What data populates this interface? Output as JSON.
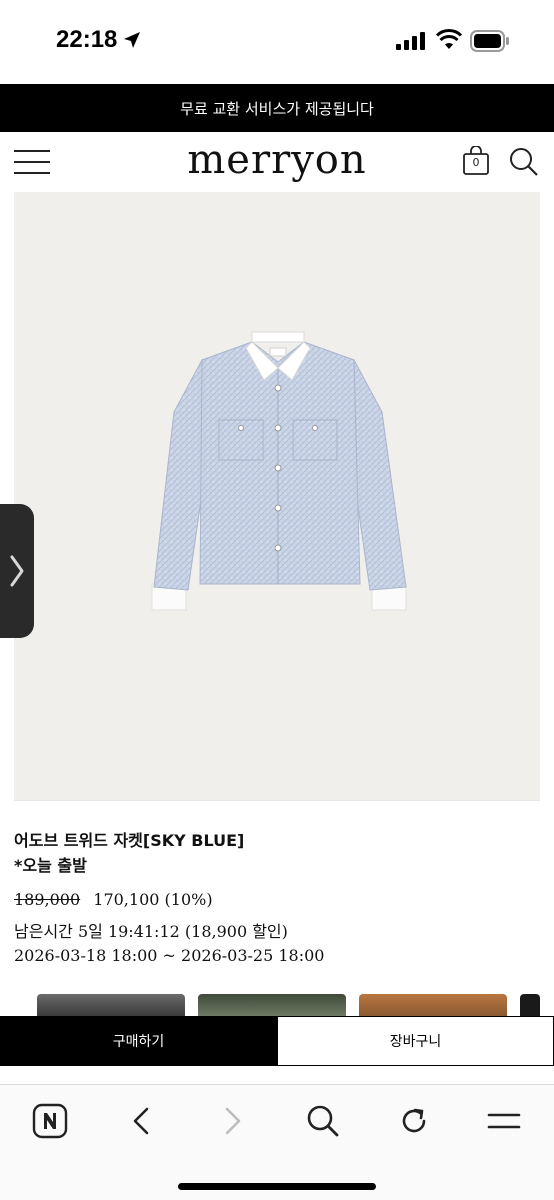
{
  "status": {
    "time": "22:18"
  },
  "promo": {
    "text": "무료 교환 서비스가 제공됩니다"
  },
  "header": {
    "logo": "merryon",
    "cart_count": "0"
  },
  "product": {
    "name": "어도브 트위드 자켓[SKY BLUE]",
    "note": "*오늘 출발",
    "original_price": "189,000",
    "sale_price": "170,100 (10%)",
    "remaining": "남은시간 5일 19:41:12 (18,900 할인)",
    "period": "2026-03-18 18:00 ~ 2026-03-25 18:00"
  },
  "actions": {
    "buy": "구매하기",
    "add_to_cart": "장바구니"
  },
  "icons": {
    "menu": "hamburger-menu-icon",
    "cart": "shopping-bag-icon",
    "search": "search-icon",
    "side": "chevron-right-icon",
    "naver": "naver-n-icon",
    "back": "chevron-left-icon",
    "forward": "chevron-right-icon",
    "refresh": "refresh-icon",
    "more": "menu-lines-icon"
  },
  "colors": {
    "banner": "#000000",
    "image_bg": "#f1efec",
    "jacket": "#c9d3e6",
    "buy_button": "#000000"
  }
}
